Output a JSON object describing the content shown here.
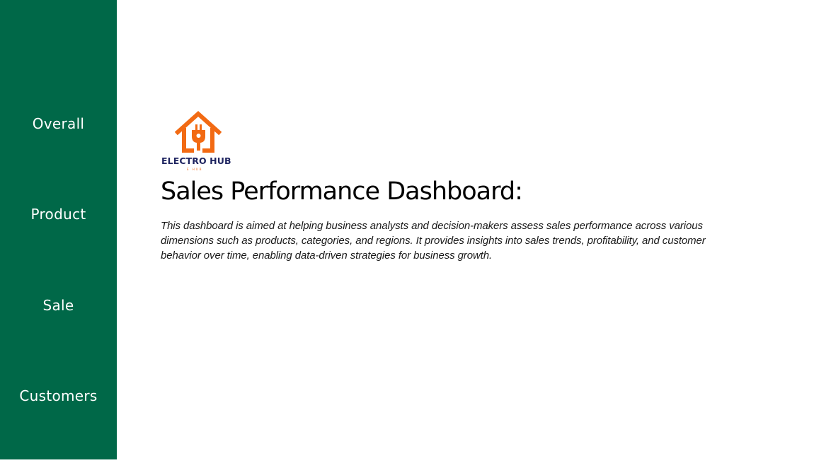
{
  "sidebar": {
    "background_color": "#006848",
    "items": [
      {
        "label": "Overall"
      },
      {
        "label": "Product"
      },
      {
        "label": "Sale"
      },
      {
        "label": "Customers"
      }
    ]
  },
  "logo": {
    "icon": "house-plug-icon",
    "icon_color": "#f26a13",
    "name": "ELECTRO HUB",
    "name_color": "#1e2460",
    "sub": "E HUB"
  },
  "main": {
    "title": "Sales Performance Dashboard:",
    "description": "This dashboard is aimed at helping business analysts and decision-makers assess sales performance across various dimensions such as products, categories, and regions. It provides insights into sales trends, profitability, and customer behavior over time, enabling data-driven strategies for business growth."
  }
}
